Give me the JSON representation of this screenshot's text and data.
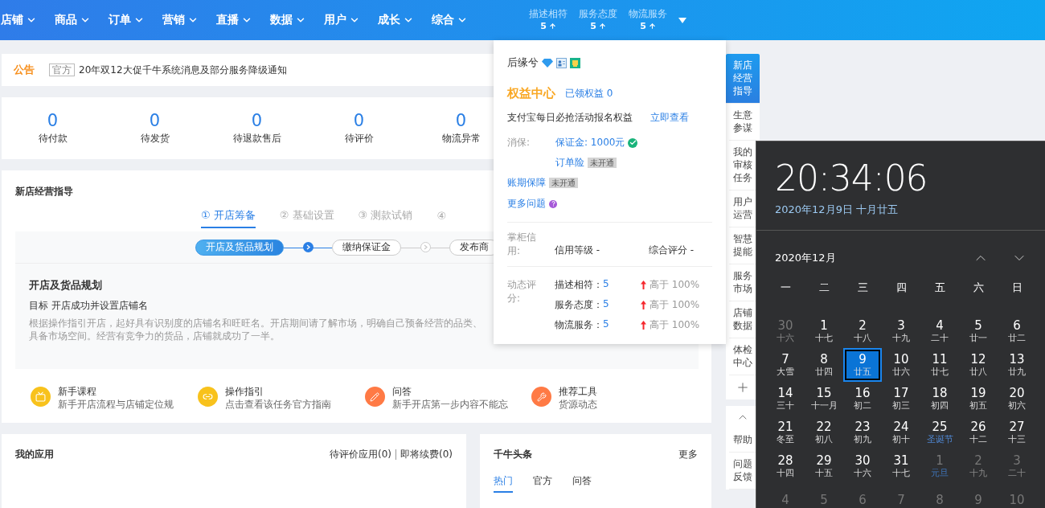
{
  "nav": {
    "items": [
      {
        "label": "店铺"
      },
      {
        "label": "商品"
      },
      {
        "label": "订单"
      },
      {
        "label": "营销"
      },
      {
        "label": "直播"
      },
      {
        "label": "数据"
      },
      {
        "label": "用户"
      },
      {
        "label": "成长"
      },
      {
        "label": "综合"
      }
    ],
    "ratings": [
      {
        "label": "描述相符",
        "value": "5"
      },
      {
        "label": "服务态度",
        "value": "5"
      },
      {
        "label": "物流服务",
        "value": "5"
      }
    ]
  },
  "notice": {
    "title": "公告",
    "tag": "官方",
    "text": "20年双12大促千牛系统消息及部分服务降级通知"
  },
  "order_stats": [
    {
      "value": "0",
      "label": "待付款"
    },
    {
      "value": "0",
      "label": "待发货"
    },
    {
      "value": "0",
      "label": "待退款售后"
    },
    {
      "value": "0",
      "label": "待评价"
    },
    {
      "value": "0",
      "label": "物流异常"
    }
  ],
  "guide": {
    "title": "新店经营指导",
    "steps": [
      {
        "number": "①",
        "label": "开店筹备",
        "selected": true
      },
      {
        "number": "②",
        "label": "基础设置",
        "selected": false
      },
      {
        "number": "③",
        "label": "测款试销",
        "selected": false
      },
      {
        "number": "④",
        "selected": false
      }
    ],
    "tasks": [
      {
        "label": "开店及货品规划",
        "selected": true
      },
      {
        "label": "缴纳保证金",
        "selected": false
      },
      {
        "label": "发布商",
        "selected": false
      }
    ],
    "heading": "开店及货品规划",
    "goal_label": "目标",
    "goal": "开店成功并设置店铺名",
    "description": [
      "根据操作指引开店，起好具有识别度的店铺名和旺旺名。开店期间请了解市场，明确自己预备经营的品类、",
      "具备市场空间。经营有竞争力的货品，店铺就成功了一半。"
    ],
    "resources": [
      {
        "kind": "course",
        "color": "#f8c21c",
        "title": "新手课程",
        "subtitle": "新手开店流程与店铺定位规"
      },
      {
        "kind": "link",
        "color": "#f8c21c",
        "title": "操作指引",
        "subtitle": "点击查看该任务官方指南"
      },
      {
        "kind": "pencil",
        "color": "#ff7a45",
        "title": "问答",
        "subtitle": "新手开店第一步内容不能忘"
      },
      {
        "kind": "wrench",
        "color": "#ff7a45",
        "title": "推荐工具",
        "subtitle": "货源动态"
      }
    ]
  },
  "apps": {
    "title": "我的应用",
    "links": [
      "待评价应用(0)",
      "即将续费(0)"
    ]
  },
  "news": {
    "title": "千牛头条",
    "more": "更多",
    "tabs": [
      {
        "label": "热门",
        "selected": true
      },
      {
        "label": "官方",
        "selected": false
      },
      {
        "label": "问答",
        "selected": false
      }
    ]
  },
  "shop_popup": {
    "shop_name": "后缘兮",
    "rights_title": "权益中心",
    "rights_claimed": "已领权益 0",
    "promo": "支付宝每日必抢活动报名权益",
    "promo_link": "立即查看",
    "protection_label": "消保:",
    "protection": [
      {
        "text": "保证金: 1000元",
        "verified": true
      },
      {
        "text": "订单险",
        "badge": "未开通"
      }
    ],
    "account_guarantee": {
      "text": "账期保障",
      "badge": "未开通"
    },
    "more": "更多问题",
    "credit_label": "掌柜信用:",
    "credit_level": "信用等级 -",
    "credit_score": "综合评分 -",
    "dynamic_label": "动态评分:",
    "dynamic": [
      {
        "name": "描述相符：",
        "value": "5",
        "compare": "高于 100%"
      },
      {
        "name": "服务态度：",
        "value": "5",
        "compare": "高于 100%"
      },
      {
        "name": "物流服务：",
        "value": "5",
        "compare": "高于 100%"
      }
    ]
  },
  "sidebar": {
    "items": [
      {
        "label": "新店经营指导",
        "selected": true
      },
      {
        "label": "生意参谋",
        "selected": false
      },
      {
        "label": "我的审核任务",
        "selected": false
      },
      {
        "label": "用户运营",
        "selected": false
      },
      {
        "label": "智慧提能",
        "selected": false
      },
      {
        "label": "服务市场",
        "selected": false
      },
      {
        "label": "店铺数据",
        "selected": false
      },
      {
        "label": "体检中心",
        "selected": false
      }
    ],
    "help": [
      {
        "label": "帮助"
      },
      {
        "label": "问题反馈"
      }
    ]
  },
  "calendar": {
    "time": "20:34:06",
    "date": "2020年12月9日 十月廿五",
    "month": "2020年12月",
    "weekdays": [
      "一",
      "二",
      "三",
      "四",
      "五",
      "六",
      "日"
    ],
    "days": [
      {
        "day": "30",
        "lunar": "十六",
        "in_month": false,
        "selected": false,
        "holiday": false
      },
      {
        "day": "1",
        "lunar": "十七",
        "in_month": true,
        "selected": false,
        "holiday": false
      },
      {
        "day": "2",
        "lunar": "十八",
        "in_month": true,
        "selected": false,
        "holiday": false
      },
      {
        "day": "3",
        "lunar": "十九",
        "in_month": true,
        "selected": false,
        "holiday": false
      },
      {
        "day": "4",
        "lunar": "二十",
        "in_month": true,
        "selected": false,
        "holiday": false
      },
      {
        "day": "5",
        "lunar": "廿一",
        "in_month": true,
        "selected": false,
        "holiday": false
      },
      {
        "day": "6",
        "lunar": "廿二",
        "in_month": true,
        "selected": false,
        "holiday": false
      },
      {
        "day": "7",
        "lunar": "大雪",
        "in_month": true,
        "selected": false,
        "holiday": false
      },
      {
        "day": "8",
        "lunar": "廿四",
        "in_month": true,
        "selected": false,
        "holiday": false
      },
      {
        "day": "9",
        "lunar": "廿五",
        "in_month": true,
        "selected": true,
        "holiday": false
      },
      {
        "day": "10",
        "lunar": "廿六",
        "in_month": true,
        "selected": false,
        "holiday": false
      },
      {
        "day": "11",
        "lunar": "廿七",
        "in_month": true,
        "selected": false,
        "holiday": false
      },
      {
        "day": "12",
        "lunar": "廿八",
        "in_month": true,
        "selected": false,
        "holiday": false
      },
      {
        "day": "13",
        "lunar": "廿九",
        "in_month": true,
        "selected": false,
        "holiday": false
      },
      {
        "day": "14",
        "lunar": "三十",
        "in_month": true,
        "selected": false,
        "holiday": false
      },
      {
        "day": "15",
        "lunar": "十一月",
        "in_month": true,
        "selected": false,
        "holiday": false
      },
      {
        "day": "16",
        "lunar": "初二",
        "in_month": true,
        "selected": false,
        "holiday": false
      },
      {
        "day": "17",
        "lunar": "初三",
        "in_month": true,
        "selected": false,
        "holiday": false
      },
      {
        "day": "18",
        "lunar": "初四",
        "in_month": true,
        "selected": false,
        "holiday": false
      },
      {
        "day": "19",
        "lunar": "初五",
        "in_month": true,
        "selected": false,
        "holiday": false
      },
      {
        "day": "20",
        "lunar": "初六",
        "in_month": true,
        "selected": false,
        "holiday": false
      },
      {
        "day": "21",
        "lunar": "冬至",
        "in_month": true,
        "selected": false,
        "holiday": false
      },
      {
        "day": "22",
        "lunar": "初八",
        "in_month": true,
        "selected": false,
        "holiday": false
      },
      {
        "day": "23",
        "lunar": "初九",
        "in_month": true,
        "selected": false,
        "holiday": false
      },
      {
        "day": "24",
        "lunar": "初十",
        "in_month": true,
        "selected": false,
        "holiday": false
      },
      {
        "day": "25",
        "lunar": "圣诞节",
        "in_month": true,
        "selected": false,
        "holiday": true
      },
      {
        "day": "26",
        "lunar": "十二",
        "in_month": true,
        "selected": false,
        "holiday": false
      },
      {
        "day": "27",
        "lunar": "十三",
        "in_month": true,
        "selected": false,
        "holiday": false
      },
      {
        "day": "28",
        "lunar": "十四",
        "in_month": true,
        "selected": false,
        "holiday": false
      },
      {
        "day": "29",
        "lunar": "十五",
        "in_month": true,
        "selected": false,
        "holiday": false
      },
      {
        "day": "30",
        "lunar": "十六",
        "in_month": true,
        "selected": false,
        "holiday": false
      },
      {
        "day": "31",
        "lunar": "十七",
        "in_month": true,
        "selected": false,
        "holiday": false
      },
      {
        "day": "1",
        "lunar": "元旦",
        "in_month": false,
        "selected": false,
        "holiday": true
      },
      {
        "day": "2",
        "lunar": "十九",
        "in_month": false,
        "selected": false,
        "holiday": false
      },
      {
        "day": "3",
        "lunar": "二十",
        "in_month": false,
        "selected": false,
        "holiday": false
      },
      {
        "day": "4",
        "in_month": false,
        "selected": false
      },
      {
        "day": "5",
        "in_month": false,
        "selected": false
      },
      {
        "day": "6",
        "in_month": false,
        "selected": false
      },
      {
        "day": "7",
        "in_month": false,
        "selected": false
      },
      {
        "day": "8",
        "in_month": false,
        "selected": false
      },
      {
        "day": "9",
        "in_month": false,
        "selected": false
      },
      {
        "day": "10",
        "in_month": false,
        "selected": false
      }
    ]
  }
}
